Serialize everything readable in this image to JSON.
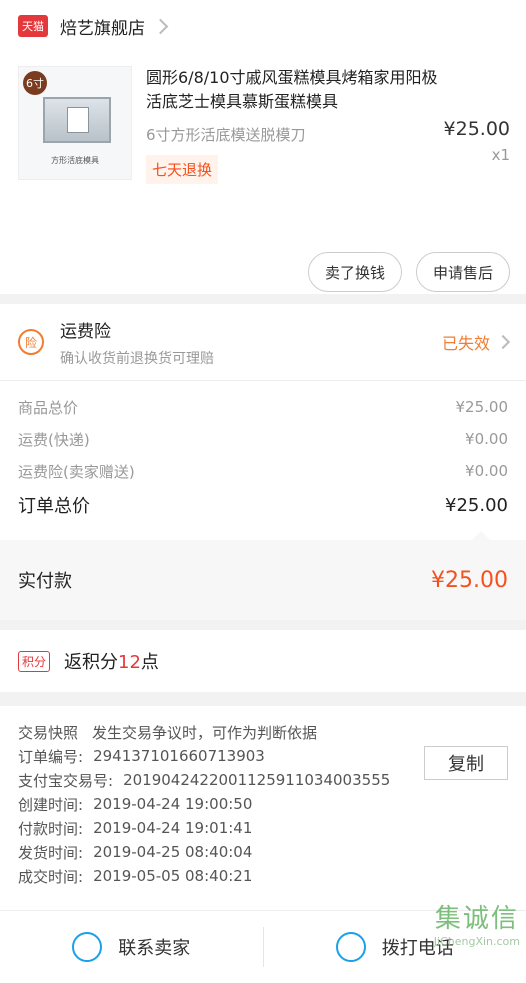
{
  "shop": {
    "badge": "天猫",
    "name": "焙艺旗舰店"
  },
  "product": {
    "size_badge": "6寸",
    "thumb_caption": "方形活底模具",
    "title": "圆形6/8/10寸戚风蛋糕模具烤箱家用阳极活底芝士模具慕斯蛋糕模具",
    "spec": "6寸方形活底模送脱模刀",
    "tag": "七天退换",
    "price": "¥25.00",
    "qty": "x1",
    "buttons": [
      "卖了换钱",
      "申请售后"
    ]
  },
  "insurance": {
    "icon_label": "险",
    "title": "运费险",
    "subtitle": "确认收货前退换货可理赔",
    "status": "已失效"
  },
  "summary": {
    "rows": [
      {
        "label": "商品总价",
        "value": "¥25.00"
      },
      {
        "label": "运费(快递)",
        "value": "¥0.00"
      },
      {
        "label": "运费险(卖家赠送)",
        "value": "¥0.00"
      }
    ],
    "total_label": "订单总价",
    "total_value": "¥25.00",
    "paid_label": "实付款",
    "paid_value": "¥25.00"
  },
  "points": {
    "badge": "积分",
    "prefix": "返积分",
    "num": "12",
    "suffix": "点"
  },
  "details": {
    "snapshot_label": "交易快照",
    "snapshot_desc": "发生交易争议时，可作为判断依据",
    "copy_label": "复制",
    "lines": [
      {
        "k": "订单编号:",
        "v": "294137101660713903"
      },
      {
        "k": "支付宝交易号:",
        "v": "2019042422001125911034003555"
      },
      {
        "k": "创建时间:",
        "v": "2019-04-24 19:00:50"
      },
      {
        "k": "付款时间:",
        "v": "2019-04-24 19:01:41"
      },
      {
        "k": "发货时间:",
        "v": "2019-04-25 08:40:04"
      },
      {
        "k": "成交时间:",
        "v": "2019-05-05 08:40:21"
      }
    ]
  },
  "actions": {
    "contact": "联系卖家",
    "call": "拨打电话"
  },
  "watermark": {
    "logo": "集诚信",
    "url": "JiChengXin.com"
  },
  "colors": {
    "accent": "#f4511e",
    "brand": "#e4393c",
    "icon_blue": "#1aa0e8"
  }
}
